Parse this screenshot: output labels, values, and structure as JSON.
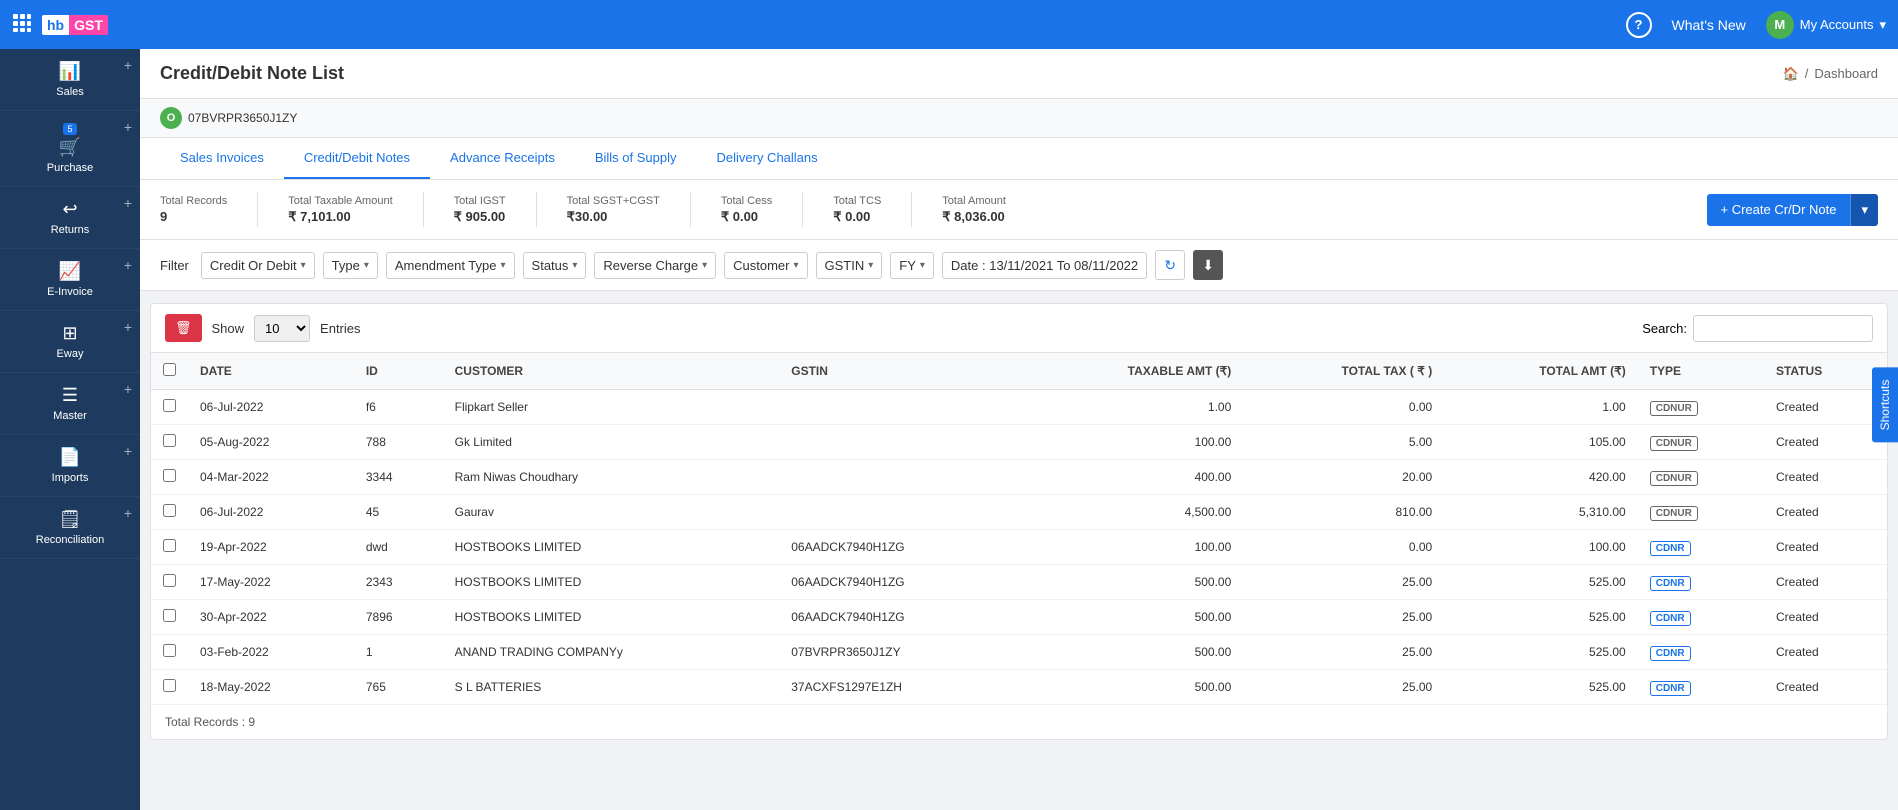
{
  "topnav": {
    "help_label": "?",
    "whats_new": "What's New",
    "my_accounts": "My Accounts",
    "avatar_letter": "M",
    "chevron": "▾"
  },
  "sidebar": {
    "items": [
      {
        "id": "sales",
        "label": "Sales",
        "icon": "📊",
        "badge": null
      },
      {
        "id": "purchase",
        "label": "Purchase",
        "icon": "🛒",
        "badge": "5"
      },
      {
        "id": "returns",
        "label": "Returns",
        "icon": "↩",
        "badge": null
      },
      {
        "id": "einvoice",
        "label": "E-Invoice",
        "icon": "📈",
        "badge": null
      },
      {
        "id": "eway",
        "label": "Eway",
        "icon": "⊞",
        "badge": null
      },
      {
        "id": "master",
        "label": "Master",
        "icon": "☰",
        "badge": null
      },
      {
        "id": "imports",
        "label": "Imports",
        "icon": "📄",
        "badge": null
      },
      {
        "id": "reconciliation",
        "label": "Reconciliation",
        "icon": "🗒",
        "badge": null
      }
    ]
  },
  "account": {
    "id": "07BVRPR3650J1ZY",
    "avatar_letter": "O"
  },
  "page": {
    "title": "Credit/Debit Note List",
    "breadcrumb_home": "🏠",
    "breadcrumb_sep": "/",
    "breadcrumb_page": "Dashboard"
  },
  "tabs": [
    {
      "id": "sales-invoices",
      "label": "Sales Invoices",
      "active": false
    },
    {
      "id": "credit-debit-notes",
      "label": "Credit/Debit Notes",
      "active": true
    },
    {
      "id": "advance-receipts",
      "label": "Advance Receipts",
      "active": false
    },
    {
      "id": "bills-of-supply",
      "label": "Bills of Supply",
      "active": false
    },
    {
      "id": "delivery-challans",
      "label": "Delivery Challans",
      "active": false
    }
  ],
  "summary": {
    "total_records_label": "Total Records",
    "total_records_value": "9",
    "total_taxable_label": "Total Taxable Amount",
    "total_taxable_value": "₹ 7,101.00",
    "total_igst_label": "Total IGST",
    "total_igst_value": "₹ 905.00",
    "total_sgst_label": "Total SGST+CGST",
    "total_sgst_value": "₹30.00",
    "total_cess_label": "Total Cess",
    "total_cess_value": "₹ 0.00",
    "total_tcs_label": "Total TCS",
    "total_tcs_value": "₹ 0.00",
    "total_amount_label": "Total Amount",
    "total_amount_value": "₹ 8,036.00",
    "create_btn_label": "+ Create Cr/Dr Note"
  },
  "filters": {
    "label": "Filter",
    "credit_or_debit": "Credit Or Debit",
    "type": "Type",
    "amendment_type": "Amendment Type",
    "status": "Status",
    "reverse_charge": "Reverse Charge",
    "customer": "Customer",
    "gstin": "GSTIN",
    "fy": "FY",
    "date_range": "Date : 13/11/2021 To 08/11/2022"
  },
  "table": {
    "show_label": "Show",
    "entries_label": "Entries",
    "entries_value": "10",
    "search_label": "Search:",
    "columns": [
      "",
      "DATE",
      "ID",
      "CUSTOMER",
      "GSTIN",
      "TAXABLE AMT (₹)",
      "TOTAL TAX ( ₹ )",
      "TOTAL AMT (₹)",
      "TYPE",
      "STATUS"
    ],
    "rows": [
      {
        "date": "06-Jul-2022",
        "id": "f6",
        "customer": "Flipkart Seller",
        "gstin": "",
        "taxable": "1.00",
        "total_tax": "0.00",
        "total_amt": "1.00",
        "type": "CDNUR",
        "status": "Created"
      },
      {
        "date": "05-Aug-2022",
        "id": "788",
        "customer": "Gk Limited",
        "gstin": "",
        "taxable": "100.00",
        "total_tax": "5.00",
        "total_amt": "105.00",
        "type": "CDNUR",
        "status": "Created"
      },
      {
        "date": "04-Mar-2022",
        "id": "3344",
        "customer": "Ram Niwas Choudhary",
        "gstin": "",
        "taxable": "400.00",
        "total_tax": "20.00",
        "total_amt": "420.00",
        "type": "CDNUR",
        "status": "Created"
      },
      {
        "date": "06-Jul-2022",
        "id": "45",
        "customer": "Gaurav",
        "gstin": "",
        "taxable": "4,500.00",
        "total_tax": "810.00",
        "total_amt": "5,310.00",
        "type": "CDNUR",
        "status": "Created"
      },
      {
        "date": "19-Apr-2022",
        "id": "dwd",
        "customer": "HOSTBOOKS LIMITED",
        "gstin": "06AADCK7940H1ZG",
        "taxable": "100.00",
        "total_tax": "0.00",
        "total_amt": "100.00",
        "type": "CDNR",
        "status": "Created"
      },
      {
        "date": "17-May-2022",
        "id": "2343",
        "customer": "HOSTBOOKS LIMITED",
        "gstin": "06AADCK7940H1ZG",
        "taxable": "500.00",
        "total_tax": "25.00",
        "total_amt": "525.00",
        "type": "CDNR",
        "status": "Created"
      },
      {
        "date": "30-Apr-2022",
        "id": "7896",
        "customer": "HOSTBOOKS LIMITED",
        "gstin": "06AADCK7940H1ZG",
        "taxable": "500.00",
        "total_tax": "25.00",
        "total_amt": "525.00",
        "type": "CDNR",
        "status": "Created"
      },
      {
        "date": "03-Feb-2022",
        "id": "1",
        "customer": "ANAND TRADING COMPANYy",
        "gstin": "07BVRPR3650J1ZY",
        "taxable": "500.00",
        "total_tax": "25.00",
        "total_amt": "525.00",
        "type": "CDNR",
        "status": "Created"
      },
      {
        "date": "18-May-2022",
        "id": "765",
        "customer": "S L BATTERIES",
        "gstin": "37ACXFS1297E1ZH",
        "taxable": "500.00",
        "total_tax": "25.00",
        "total_amt": "525.00",
        "type": "CDNR",
        "status": "Created"
      }
    ],
    "total_records_label": "Total Records : 9"
  },
  "shortcuts": "Shortcuts"
}
